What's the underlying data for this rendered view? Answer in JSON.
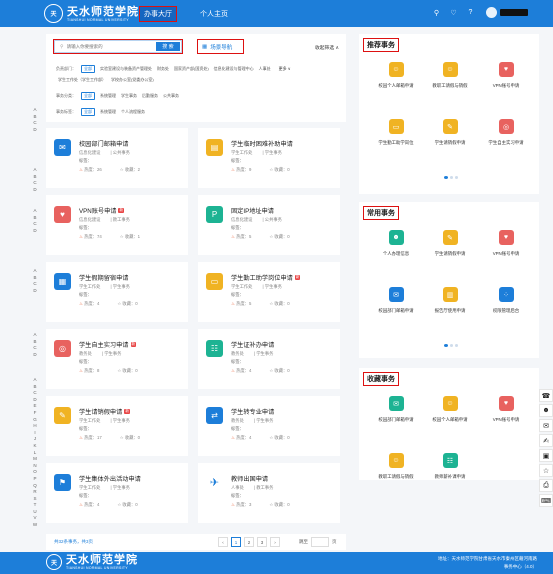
{
  "header": {
    "school_name_cn": "天水师范学院",
    "school_name_en": "TIANSHUI NORMAL UNIVERSITY",
    "nav": [
      "办事大厅",
      "个人主页"
    ],
    "icons": [
      "search-icon",
      "bell-icon",
      "help-icon",
      "user-avatar-icon"
    ]
  },
  "alpha_groups": [
    {
      "letters": [
        "A",
        "B",
        "C",
        "D"
      ]
    },
    {
      "letters": [
        "A",
        "B",
        "C",
        "D"
      ]
    },
    {
      "letters": [
        "A",
        "B",
        "C",
        "D"
      ]
    },
    {
      "letters": [
        "A",
        "B",
        "C",
        "D"
      ]
    },
    {
      "letters": [
        "A",
        "B",
        "C",
        "D"
      ]
    },
    {
      "letters": [
        "A",
        "B",
        "C",
        "D",
        "E",
        "F",
        "G",
        "H",
        "I",
        "J",
        "K",
        "L",
        "M",
        "N",
        "O",
        "P",
        "Q",
        "R",
        "S",
        "T",
        "U",
        "V",
        "W"
      ]
    }
  ],
  "filter": {
    "search_placeholder": "请输入你要搜索的",
    "search_button": "搜 索",
    "scene_nav": "场景导航",
    "collapse": "收起筛选 ∧",
    "dept_label": "负责部门：",
    "dept_options": [
      "全部",
      "实验室建设与装备资产管理处",
      "财务处",
      "国家资产部(国资处)",
      "信息化建设与管理中心",
      "人事处"
    ],
    "dept_more": "更多 ∨",
    "dept_options_row2": [
      "学生工作处（学生工作部）",
      "学校办公室(党委办公室)"
    ],
    "type_label": "事务分类：",
    "type_options": [
      "全部",
      "系统管理",
      "学生事务",
      "后勤服务",
      "公共事务"
    ],
    "tag_label": "事务标签：",
    "tag_options": [
      "全部",
      "系统管理",
      "个人流程服务"
    ]
  },
  "services": [
    {
      "title": "校园部门邮箱申请",
      "badge": "",
      "dept": "信息化建设",
      "category": "公共事务",
      "tag_label": "标签：",
      "heat": "热度：26",
      "fav": "收藏：2",
      "color": "#1d7ed9",
      "icon": "mail-icon",
      "glyph": "✉"
    },
    {
      "title": "学生临时困难补助申请",
      "badge": "",
      "dept": "学生工作处",
      "category": "学生事务",
      "tag_label": "标签：",
      "heat": "热度：9",
      "fav": "收藏：0",
      "color": "#f0b323",
      "icon": "aid-icon",
      "glyph": "▤"
    },
    {
      "title": "VPN账号申请",
      "badge": "新",
      "dept": "信息化建设",
      "category": "教工事务",
      "tag_label": "标签：",
      "heat": "热度：74",
      "fav": "收藏：1",
      "color": "#e8625f",
      "icon": "vpn-icon",
      "glyph": "♥"
    },
    {
      "title": "固定IP地址申请",
      "badge": "",
      "dept": "信息化建设",
      "category": "公共事务",
      "tag_label": "标签：",
      "heat": "热度：5",
      "fav": "收藏：0",
      "color": "#1db393",
      "icon": "ip-address-icon",
      "glyph": "P"
    },
    {
      "title": "学生假期留宿申请",
      "badge": "",
      "dept": "学生工作处",
      "category": "学生事务",
      "tag_label": "标签：",
      "heat": "热度：4",
      "fav": "收藏：0",
      "color": "#1d7ed9",
      "icon": "dorm-icon",
      "glyph": "▦"
    },
    {
      "title": "学生勤工助学岗位申请",
      "badge": "新",
      "dept": "学生工作处",
      "category": "学生事务",
      "tag_label": "标签：",
      "heat": "热度：5",
      "fav": "收藏：0",
      "color": "#f0b323",
      "icon": "wallet-icon",
      "glyph": "▭"
    },
    {
      "title": "学生自主实习申请",
      "badge": "新",
      "dept": "教务处",
      "category": "学生事务",
      "tag_label": "标签：",
      "heat": "热度：8",
      "fav": "收藏：0",
      "color": "#e8625f",
      "icon": "target-icon",
      "glyph": "◎"
    },
    {
      "title": "学生证补办申请",
      "badge": "",
      "dept": "教务处",
      "category": "学生事务",
      "tag_label": "标签：",
      "heat": "热度：4",
      "fav": "收藏：0",
      "color": "#1db393",
      "icon": "student-card-icon",
      "glyph": "☷"
    },
    {
      "title": "学生请销假申请",
      "badge": "新",
      "dept": "学生工作处",
      "category": "学生事务",
      "tag_label": "标签：",
      "heat": "热度：17",
      "fav": "收藏：0",
      "color": "#f0b323",
      "icon": "leave-icon",
      "glyph": "✎"
    },
    {
      "title": "学生转专业申请",
      "badge": "",
      "dept": "教务处",
      "category": "学生事务",
      "tag_label": "标签：",
      "heat": "热度：4",
      "fav": "收藏：0",
      "color": "#1d7ed9",
      "icon": "transfer-icon",
      "glyph": "⇄"
    },
    {
      "title": "学生集体外出活动申请",
      "badge": "",
      "dept": "学生工作处",
      "category": "学生事务",
      "tag_label": "标签：",
      "heat": "热度：4",
      "fav": "收藏：0",
      "color": "#1d7ed9",
      "icon": "group-activity-icon",
      "glyph": "⚑"
    },
    {
      "title": "教师出国申请",
      "badge": "",
      "dept": "人事处",
      "category": "教工事务",
      "tag_label": "标签：",
      "heat": "热度：3",
      "fav": "收藏：0",
      "color": "#ffffff",
      "icon": "airplane-icon",
      "glyph": "✈"
    }
  ],
  "pager": {
    "total": "共32条事务，共3页",
    "prev": "‹",
    "pages": [
      "1",
      "2",
      "3"
    ],
    "next": "›",
    "jump_label": "跳至",
    "page_unit": "页"
  },
  "recommended": {
    "title": "推荐事务",
    "items": [
      {
        "name": "校园个人邮箱申请",
        "icon": "user-mail-icon",
        "glyph": "☺",
        "color": "#f0b323"
      },
      {
        "name": "教职工请假与销假",
        "icon": "staff-leave-icon",
        "glyph": "☺",
        "color": "#f0b323"
      },
      {
        "name": "VPN账号申请",
        "icon": "vpn-icon",
        "glyph": "♥",
        "color": "#e8625f"
      },
      {
        "name": "学生勤工助学岗位",
        "icon": "wallet-icon",
        "glyph": "▭",
        "color": "#f0b323"
      },
      {
        "name": "学生请销假申请",
        "icon": "leave-icon",
        "glyph": "✎",
        "color": "#f0b323"
      },
      {
        "name": "学生自主实习申请",
        "icon": "target-icon",
        "glyph": "◎",
        "color": "#e8625f"
      }
    ]
  },
  "common": {
    "title": "常用事务",
    "items": [
      {
        "name": "个人办理信息",
        "icon": "person-info-icon",
        "glyph": "☻",
        "color": "#1db393"
      },
      {
        "name": "学生请销假申请",
        "icon": "leave-icon",
        "glyph": "✎",
        "color": "#f0b323"
      },
      {
        "name": "VPN账号申请",
        "icon": "vpn-icon",
        "glyph": "♥",
        "color": "#e8625f"
      },
      {
        "name": "校园部门邮箱申请",
        "icon": "mail-icon",
        "glyph": "✉",
        "color": "#1d7ed9"
      },
      {
        "name": "报告厅使用申请",
        "icon": "hall-icon",
        "glyph": "▥",
        "color": "#f0b323"
      },
      {
        "name": "权限管理后台",
        "icon": "admin-grid-icon",
        "glyph": "⁘",
        "color": "#1d7ed9"
      }
    ]
  },
  "favorites": {
    "title": "收藏事务",
    "items": [
      {
        "name": "校园部门邮箱申请",
        "icon": "mail-icon",
        "glyph": "✉",
        "color": "#1db393"
      },
      {
        "name": "校园个人邮箱申请",
        "icon": "user-mail-icon",
        "glyph": "☺",
        "color": "#f0b323"
      },
      {
        "name": "VPN账号申请",
        "icon": "vpn-icon",
        "glyph": "♥",
        "color": "#e8625f"
      },
      {
        "name": "教职工请假与销假",
        "icon": "staff-leave-icon",
        "glyph": "☺",
        "color": "#f0b323"
      },
      {
        "name": "教师薪补课申请",
        "icon": "teacher-pay-icon",
        "glyph": "☷",
        "color": "#1db393"
      }
    ]
  },
  "float_tools": [
    {
      "icon": "chat-icon",
      "glyph": "☎"
    },
    {
      "icon": "user-card-icon",
      "glyph": "☻"
    },
    {
      "icon": "message-icon",
      "glyph": "✉"
    },
    {
      "icon": "feedback-icon",
      "glyph": "✍"
    },
    {
      "icon": "calendar-icon",
      "glyph": "▣"
    },
    {
      "icon": "star-icon",
      "glyph": "☆"
    },
    {
      "icon": "print-icon",
      "glyph": "⎙"
    },
    {
      "icon": "keyboard-icon",
      "glyph": "⌨"
    }
  ],
  "footer": {
    "school_name_cn": "天水师范学院",
    "school_name_en": "TIANSHUI NORMAL UNIVERSITY",
    "address": "地址：天水师范学院甘肃省天水市秦州区藉河南路",
    "center": "事务中心（4.0）"
  }
}
